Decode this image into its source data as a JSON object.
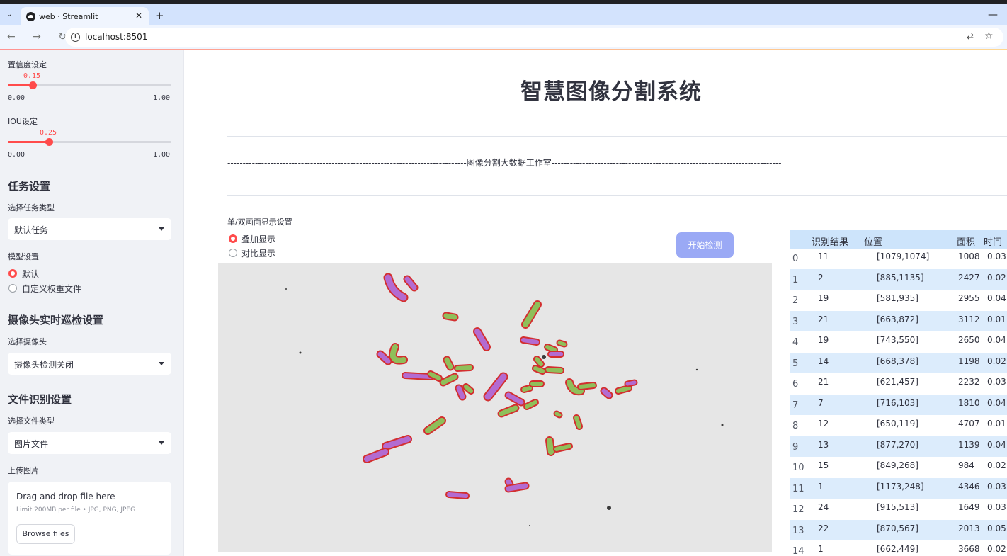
{
  "browser": {
    "tab_title": "web · Streamlit",
    "tab_close": "✕",
    "new_tab": "+",
    "tab_menu": "⌄",
    "minimize": "—",
    "nav": "← → ↻",
    "url": "localhost:8501",
    "translate_icon": "⇄",
    "star_icon": "☆"
  },
  "sidebar": {
    "confidence": {
      "label": "置信度设定",
      "value_text": "0.15",
      "value": 0.15,
      "min": "0.00",
      "max": "1.00"
    },
    "iou": {
      "label": "IOU设定",
      "value_text": "0.25",
      "value": 0.25,
      "min": "0.00",
      "max": "1.00"
    },
    "task_heading": "任务设置",
    "task_type_label": "选择任务类型",
    "task_type_value": "默认任务",
    "model_label": "模型设置",
    "model_options": [
      "默认",
      "自定义权重文件"
    ],
    "model_selected": 0,
    "camera_heading": "摄像头实时巡检设置",
    "camera_label": "选择摄像头",
    "camera_value": "摄像头检测关闭",
    "file_heading": "文件识别设置",
    "file_type_label": "选择文件类型",
    "file_type_value": "图片文件",
    "upload_label": "上传图片",
    "upload_drag": "Drag and drop file here",
    "upload_limit": "Limit 200MB per file • JPG, PNG, JPEG",
    "upload_button": "Browse files"
  },
  "main": {
    "title": "智慧图像分割系统",
    "subtitle": "------------------------------------------------------------------------------图像分割大数据工作室---------------------------------------------------------------------------",
    "display_label": "单/双画面显示设置",
    "display_options": [
      "叠加显示",
      "对比显示"
    ],
    "display_selected": 0,
    "start_button": "开始检测"
  },
  "table": {
    "headers": [
      "识别结果",
      "位置",
      "面积",
      "时间"
    ],
    "rows": [
      {
        "idx": "0",
        "result": "11",
        "pos": "[1079,1074]",
        "area": "1008",
        "time": "0.03"
      },
      {
        "idx": "1",
        "result": "2",
        "pos": "[885,1135]",
        "area": "2427",
        "time": "0.02"
      },
      {
        "idx": "2",
        "result": "19",
        "pos": "[581,935]",
        "area": "2955",
        "time": "0.04"
      },
      {
        "idx": "3",
        "result": "21",
        "pos": "[663,872]",
        "area": "3112",
        "time": "0.01"
      },
      {
        "idx": "4",
        "result": "19",
        "pos": "[743,550]",
        "area": "2650",
        "time": "0.04"
      },
      {
        "idx": "5",
        "result": "14",
        "pos": "[668,378]",
        "area": "1198",
        "time": "0.02"
      },
      {
        "idx": "6",
        "result": "21",
        "pos": "[621,457]",
        "area": "2232",
        "time": "0.03"
      },
      {
        "idx": "7",
        "result": "7",
        "pos": "[716,103]",
        "area": "1810",
        "time": "0.04"
      },
      {
        "idx": "8",
        "result": "12",
        "pos": "[650,119]",
        "area": "4707",
        "time": "0.01"
      },
      {
        "idx": "9",
        "result": "13",
        "pos": "[877,270]",
        "area": "1139",
        "time": "0.04"
      },
      {
        "idx": "10",
        "result": "15",
        "pos": "[849,268]",
        "area": "984",
        "time": "0.02"
      },
      {
        "idx": "11",
        "result": "1",
        "pos": "[1173,248]",
        "area": "4346",
        "time": "0.03"
      },
      {
        "idx": "12",
        "result": "24",
        "pos": "[915,513]",
        "area": "1649",
        "time": "0.03"
      },
      {
        "idx": "13",
        "result": "22",
        "pos": "[870,567]",
        "area": "2013",
        "time": "0.05"
      },
      {
        "idx": "14",
        "result": "1",
        "pos": "[662,449]",
        "area": "3668",
        "time": "0.02"
      }
    ]
  },
  "colors": {
    "accent": "#ff4b4b",
    "sidebar_bg": "#f0f2f6",
    "button_bg": "#9aa9f5",
    "table_header": "#cde4fb",
    "table_alt": "#dcecfc",
    "mask_green": "#8fbf5a",
    "mask_purple": "#b36bd1",
    "mask_outline": "#d32f2f"
  }
}
